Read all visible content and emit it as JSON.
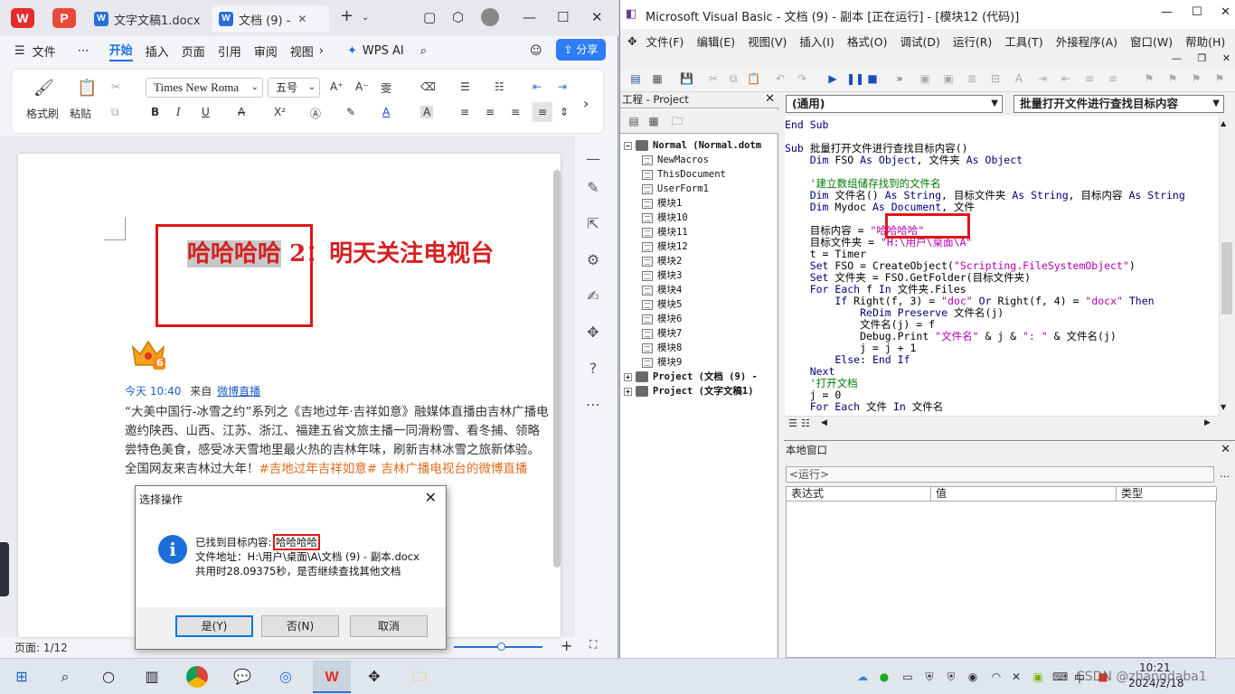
{
  "wps": {
    "tabs": [
      {
        "label": "文字文稿1.docx"
      },
      {
        "label": "文档 (9) -"
      }
    ],
    "menu": [
      "文件",
      "⋯",
      "开始",
      "插入",
      "页面",
      "引用",
      "审阅",
      "视图"
    ],
    "active_menu": "开始",
    "wps_ai": "WPS AI",
    "share": "分享",
    "ribbon": {
      "format_painter": "格式刷",
      "paste": "粘贴",
      "font_name": "Times New Roma",
      "font_size": "五号"
    },
    "document": {
      "title_highlight": "哈哈哈哈",
      "title_rest": " 2：明天关注电视台",
      "crown_badge": "6",
      "meta_time": "今天 10:40",
      "meta_from": "来自",
      "meta_source": "微博直播",
      "body_lines": [
        "“大美中国行-冰雪之约”系列之《吉地过年·吉祥如意》融媒体直播由吉林广播电",
        "邀约陕西、山西、江苏、浙江、福建五省文旅主播一同滑粉雪、看冬捕、领略",
        "尝特色美食，感受冰天雪地里最火热的吉林年味，刷新吉林冰雪之旅新体验。",
        "全国网友来吉林过大年！"
      ],
      "body_tags": "#吉地过年吉祥如意# 吉林广播电视台的微博直播"
    },
    "status": {
      "page": "页面: 1/12"
    }
  },
  "dialog": {
    "title": "选择操作",
    "found_label": "已找到目标内容:",
    "found_value": "哈哈哈哈",
    "path_line": "文件地址：H:\\用户\\桌面\\A\\文档 (9) - 副本.docx",
    "time_line": "共用时28.09375秒，是否继续查找其他文档",
    "yes": "是(Y)",
    "no": "否(N)",
    "cancel": "取消"
  },
  "vb": {
    "title": "Microsoft Visual Basic - 文档 (9) - 副本 [正在运行] - [模块12 (代码)]",
    "menu": [
      "文件(F)",
      "编辑(E)",
      "视图(V)",
      "插入(I)",
      "格式(O)",
      "调试(D)",
      "运行(R)",
      "工具(T)",
      "外接程序(A)",
      "窗口(W)",
      "帮助(H)"
    ],
    "project_title": "工程 - Project",
    "tree": [
      {
        "label": "Normal (Normal.dotm",
        "level": 0,
        "bold": true
      },
      {
        "label": "NewMacros",
        "level": 1
      },
      {
        "label": "ThisDocument",
        "level": 1
      },
      {
        "label": "UserForm1",
        "level": 1
      },
      {
        "label": "模块1",
        "level": 1
      },
      {
        "label": "模块10",
        "level": 1
      },
      {
        "label": "模块11",
        "level": 1
      },
      {
        "label": "模块12",
        "level": 1
      },
      {
        "label": "模块2",
        "level": 1
      },
      {
        "label": "模块3",
        "level": 1
      },
      {
        "label": "模块4",
        "level": 1
      },
      {
        "label": "模块5",
        "level": 1
      },
      {
        "label": "模块6",
        "level": 1
      },
      {
        "label": "模块7",
        "level": 1
      },
      {
        "label": "模块8",
        "level": 1
      },
      {
        "label": "模块9",
        "level": 1
      },
      {
        "label": "Project (文档 (9) -",
        "level": 0,
        "bold": true
      },
      {
        "label": "Project (文字文稿1)",
        "level": 0,
        "bold": true
      }
    ],
    "combo_left": "(通用)",
    "combo_right": "批量打开文件进行查找目标内容",
    "code_lines": [
      "End Sub",
      "",
      "Sub 批量打开文件进行查找目标内容()",
      "    Dim FSO As Object, 文件夹 As Object",
      "",
      "    '建立数组储存找到的文件名",
      "    Dim 文件名() As String, 目标文件夹 As String, 目标内容 As String",
      "    Dim Mydoc As Document, 文件",
      "",
      "    目标内容 = \"哈哈哈哈\"",
      "    目标文件夹 = \"H:\\用户\\桌面\\A\"",
      "    t = Timer",
      "    Set FSO = CreateObject(\"Scripting.FileSystemObject\")",
      "    Set 文件夹 = FSO.GetFolder(目标文件夹)",
      "    For Each f In 文件夹.Files",
      "        If Right(f, 3) = \"doc\" Or Right(f, 4) = \"docx\" Then",
      "            ReDim Preserve 文件名(j)",
      "            文件名(j) = f",
      "            Debug.Print \"文件名\" & j & \": \" & 文件名(j)",
      "            j = j + 1",
      "        Else: End If",
      "    Next",
      "    '打开文档",
      "    j = 0",
      "    For Each 文件 In 文件名"
    ],
    "locals_title": "本地窗口",
    "locals_context": "<运行>",
    "locals_cols": [
      "表达式",
      "值",
      "类型"
    ]
  },
  "taskbar": {
    "time": "10:21",
    "date": "2024/2/18",
    "ime": "中",
    "watermark": "CSDN @zhangdaba1"
  }
}
